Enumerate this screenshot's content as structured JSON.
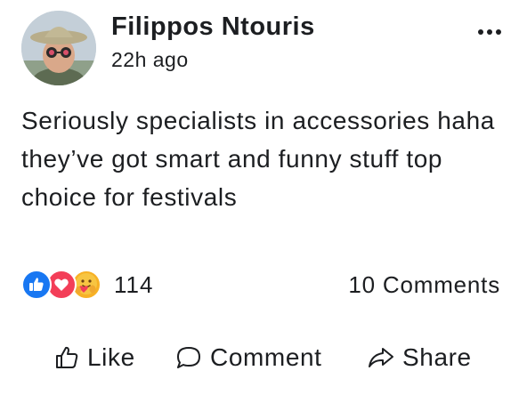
{
  "post": {
    "author": "Filippos Ntouris",
    "timestamp": "22h ago",
    "body": "Seriously specialists in accessories haha they’ve got smart and funny stuff top choice for festivals",
    "reactions": {
      "icons": [
        "like-icon",
        "love-icon",
        "care-icon"
      ],
      "count": "114"
    },
    "comments_count": "10 Comments",
    "menu_icon": "more-horizontal-icon"
  },
  "actions": {
    "like_label": "Like",
    "comment_label": "Comment",
    "share_label": "Share"
  },
  "colors": {
    "like": "#1877f2",
    "love": "#f33e58",
    "care": "#f7b125",
    "text": "#1c1e21"
  }
}
